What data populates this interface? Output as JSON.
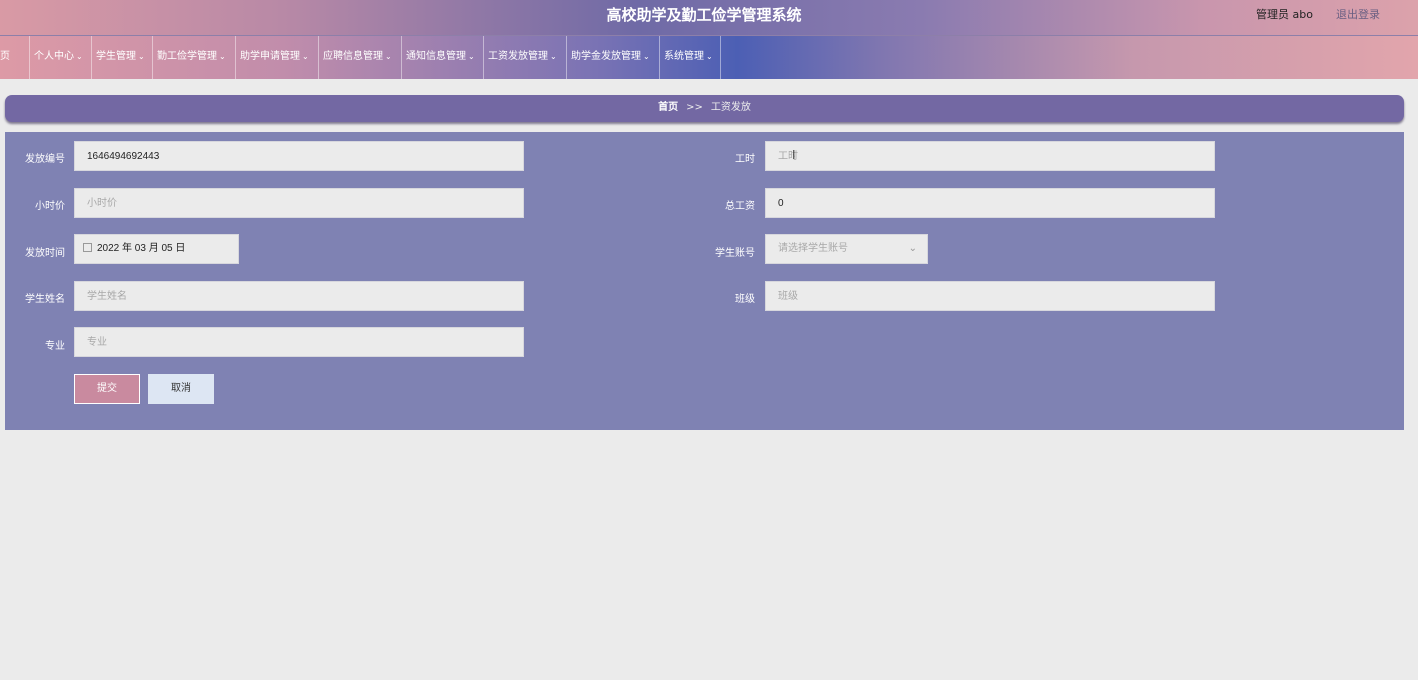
{
  "header": {
    "title": "高校助学及勤工俭学管理系统",
    "admin": "管理员 abo",
    "logout": "退出登录"
  },
  "nav": {
    "items": [
      {
        "label": "首页",
        "has_dropdown": false
      },
      {
        "label": "个人中心",
        "has_dropdown": true
      },
      {
        "label": "学生管理",
        "has_dropdown": true
      },
      {
        "label": "勤工俭学管理",
        "has_dropdown": true
      },
      {
        "label": "助学申请管理",
        "has_dropdown": true
      },
      {
        "label": "应聘信息管理",
        "has_dropdown": true
      },
      {
        "label": "通知信息管理",
        "has_dropdown": true
      },
      {
        "label": "工资发放管理",
        "has_dropdown": true
      },
      {
        "label": "助学金发放管理",
        "has_dropdown": true
      },
      {
        "label": "系统管理",
        "has_dropdown": true
      }
    ],
    "chevron": "⌄"
  },
  "breadcrumb": {
    "home": "首页",
    "separator": ">>",
    "current": "工资发放"
  },
  "form": {
    "fafang_bianhao": {
      "label": "发放编号",
      "value": "1646494692443"
    },
    "gongshi": {
      "label": "工时",
      "placeholder": "工时"
    },
    "xiaoshijia": {
      "label": "小时价",
      "placeholder": "小时价"
    },
    "zonggongzi": {
      "label": "总工资",
      "value": "0"
    },
    "fafang_shijian": {
      "label": "发放时间",
      "value": "2022 年 03 月 05 日"
    },
    "xuesheng_zhanghao": {
      "label": "学生账号",
      "placeholder": "请选择学生账号"
    },
    "xuesheng_xingming": {
      "label": "学生姓名",
      "placeholder": "学生姓名"
    },
    "banji": {
      "label": "班级",
      "placeholder": "班级"
    },
    "zhuanye": {
      "label": "专业",
      "placeholder": "专业"
    },
    "submit": "提交",
    "cancel": "取消"
  },
  "colors": {
    "panel": "#7f82b3",
    "breadcrumb": "#7368a3",
    "submit_button": "#c98a9f",
    "cancel_button": "#dde6f3"
  }
}
